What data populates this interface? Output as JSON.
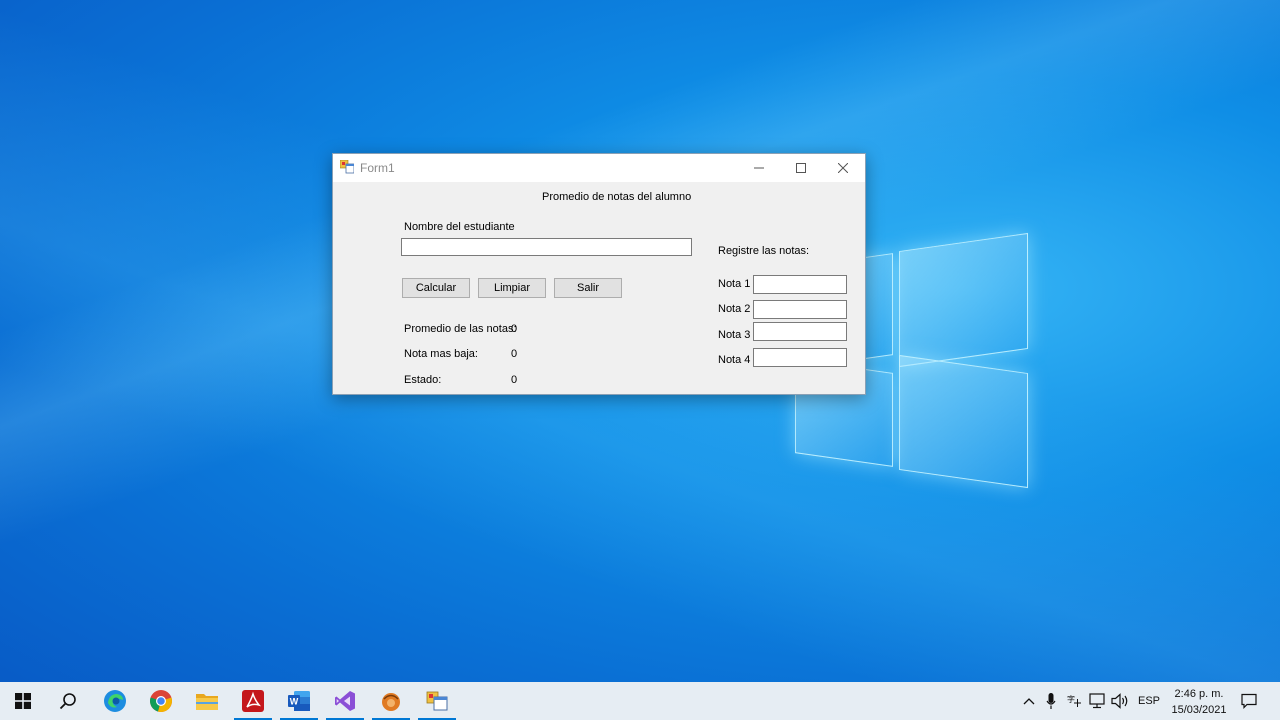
{
  "window": {
    "title": "Form1",
    "header": "Promedio de notas del alumno",
    "student_label": "Nombre del estudiante",
    "student_value": "",
    "buttons": {
      "calcular": "Calcular",
      "limpiar": "Limpiar",
      "salir": "Salir"
    },
    "results": {
      "promedio_label": "Promedio de las notas:",
      "promedio_value": "0",
      "baja_label": "Nota mas baja:",
      "baja_value": "0",
      "estado_label": "Estado:",
      "estado_value": "0"
    },
    "notas": {
      "header": "Registre las notas:",
      "items": [
        {
          "label": "Nota 1",
          "value": ""
        },
        {
          "label": "Nota 2",
          "value": ""
        },
        {
          "label": "Nota 3",
          "value": ""
        },
        {
          "label": "Nota 4",
          "value": ""
        }
      ]
    }
  },
  "taskbar": {
    "apps": [
      "start-icon",
      "search-icon",
      "edge-icon",
      "chrome-icon",
      "file-explorer-icon",
      "acrobat-icon",
      "word-icon",
      "visual-studio-icon",
      "app-icon",
      "form-app-icon"
    ],
    "language": "ESP",
    "time": "2:46 p. m.",
    "date": "15/03/2021"
  },
  "colors": {
    "accent": "#0078d4",
    "desktop": "#0a6fd4"
  }
}
